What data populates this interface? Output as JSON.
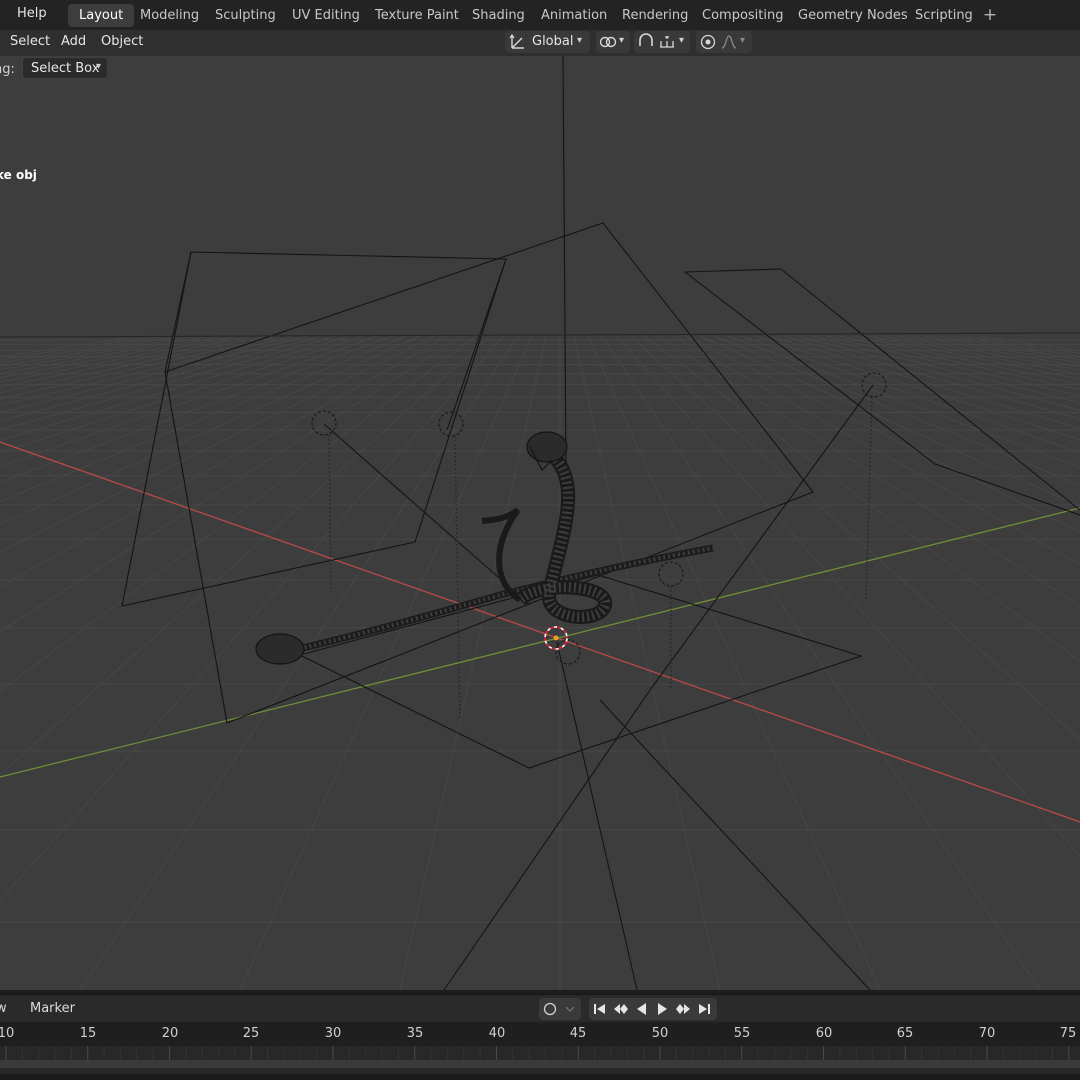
{
  "topbar": {
    "help_label": "Help",
    "workspaces": [
      "Layout",
      "Modeling",
      "Sculpting",
      "UV Editing",
      "Texture Paint",
      "Shading",
      "Animation",
      "Rendering",
      "Compositing",
      "Geometry Nodes",
      "Scripting"
    ],
    "active_workspace": "Layout",
    "add_workspace": "+"
  },
  "header": {
    "menus": [
      "Select",
      "Add",
      "Object"
    ],
    "transform_orientation": "Global",
    "icons": [
      "transform-orientation-icon",
      "pivot-link-icon",
      "snap-magnet-icon",
      "snap-increment-icon",
      "proportional-editing-icon",
      "falloff-curve-icon"
    ]
  },
  "tool_options": {
    "drag_label": "ng:",
    "select_mode": "Select Box"
  },
  "viewport": {
    "object_name": "ke obj",
    "colors": {
      "x_axis": "#b84a4a",
      "y_axis": "#6d8f36",
      "grid": "#4a4a4a",
      "wire": "#151515",
      "origin": "#f0a020"
    }
  },
  "timeline": {
    "menus": [
      "ew",
      "Marker"
    ],
    "frames": [
      "10",
      "15",
      "20",
      "25",
      "30",
      "35",
      "40",
      "45",
      "50",
      "55",
      "60",
      "65",
      "70",
      "75"
    ],
    "playback_icons": [
      "jump-start-icon",
      "prev-keyframe-icon",
      "play-reverse-icon",
      "play-icon",
      "next-keyframe-icon",
      "jump-end-icon"
    ]
  }
}
